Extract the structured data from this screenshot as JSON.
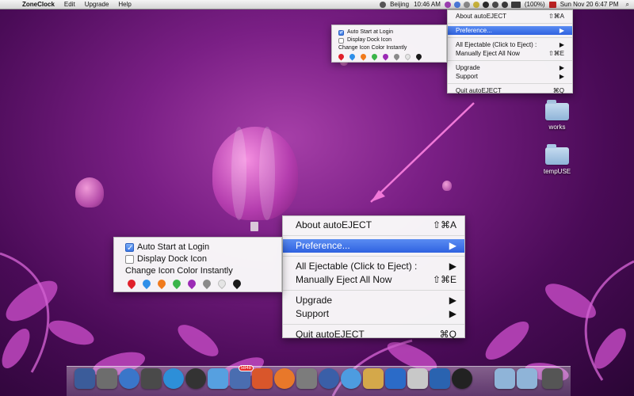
{
  "menubar": {
    "apple_glyph": "",
    "app_name": "ZoneClock",
    "menus": [
      "Edit",
      "Upgrade",
      "Help"
    ],
    "city": "Beijing",
    "city_time": "10:46 AM",
    "battery": "(100%)",
    "date_time": "Sun Nov 20  6:47 PM",
    "search_glyph": "⌕"
  },
  "menu": {
    "items": [
      {
        "label": "About autoEJECT",
        "shortcut": "⇧⌘A"
      },
      {
        "label": "Preference...",
        "shortcut": "▶",
        "highlighted": true
      },
      {
        "label": "All Ejectable (Click to Eject) :",
        "shortcut": "▶"
      },
      {
        "label": "Manually Eject All Now",
        "shortcut": "⇧⌘E"
      },
      {
        "label": "Upgrade",
        "shortcut": "▶"
      },
      {
        "label": "Support",
        "shortcut": "▶"
      },
      {
        "label": "Quit autoEJECT",
        "shortcut": "⌘Q"
      }
    ]
  },
  "preference": {
    "auto_start": "Auto Start at Login",
    "auto_start_checked": true,
    "display_dock_icon": "Display Dock Icon",
    "display_dock_checked": false,
    "change_color": "Change Icon Color Instantly",
    "pin_colors": [
      "#e0202a",
      "#2f8fe8",
      "#f07a1c",
      "#3bb54a",
      "#9b2bb5",
      "#8a8a8a",
      "#e4e4e4",
      "#1a1a1a"
    ]
  },
  "desktop": {
    "folders": [
      {
        "label": "works"
      },
      {
        "label": "tempUSE"
      }
    ]
  },
  "dock": {
    "mail_badge": "5848",
    "icon_colors": [
      "#3b5c9a",
      "#6d6d6d",
      "#3a76c9",
      "#4a4a4a",
      "#2d8fd8",
      "#333333",
      "#56a0e0",
      "#4a6db0",
      "#d9562b",
      "#e8782a",
      "#7c7c7c",
      "#3a5fa8",
      "#4d9ce0",
      "#d4a84a",
      "#2b6bc8",
      "#c8c8c8",
      "#2a63b0",
      "#222222",
      "#8fb4d8",
      "#8fb4d8",
      "#555555"
    ]
  }
}
